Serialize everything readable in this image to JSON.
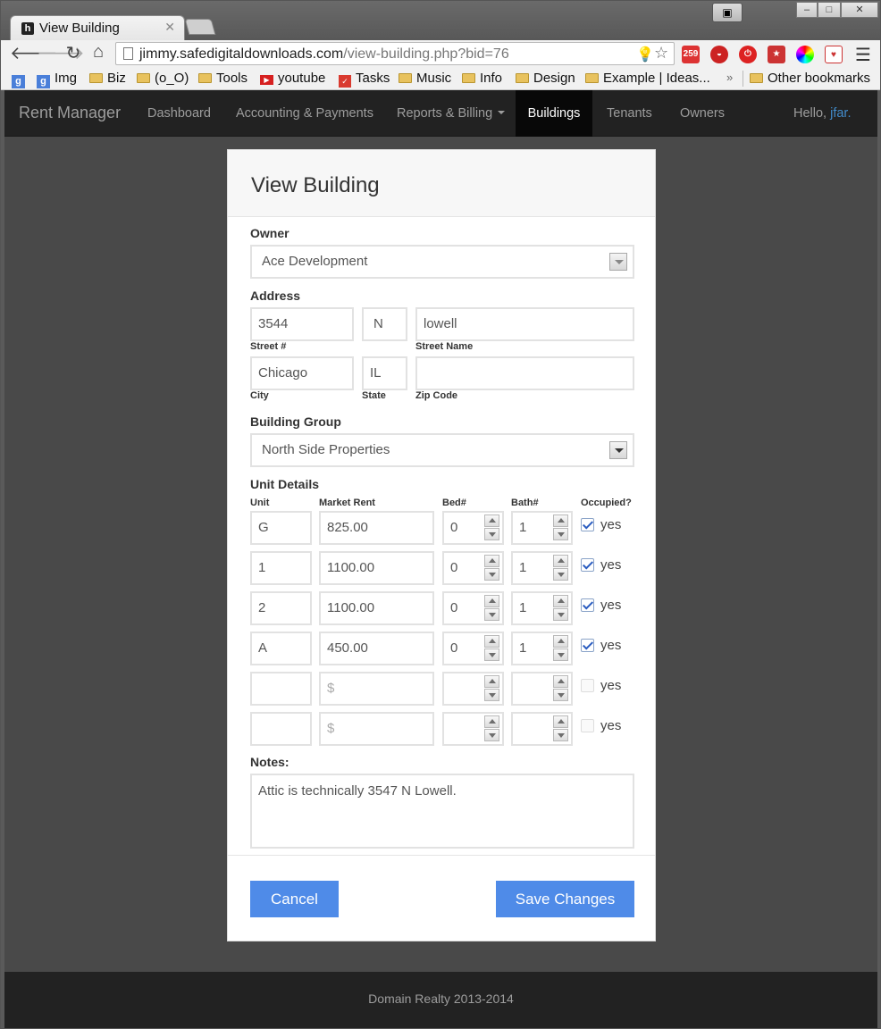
{
  "browser": {
    "tab_title": "View Building",
    "url_host": "jimmy.safedigitaldownloads.com",
    "url_path": "/view-building.php?bid=76",
    "badge_count": "259",
    "bookmarks": [
      {
        "label": "",
        "icon": "google-icon"
      },
      {
        "label": "Img",
        "icon": "google-icon"
      },
      {
        "label": "Biz",
        "icon": "folder-icon"
      },
      {
        "label": "(o_O)",
        "icon": "folder-icon"
      },
      {
        "label": "Tools",
        "icon": "folder-icon"
      },
      {
        "label": "youtube",
        "icon": "youtube-icon"
      },
      {
        "label": "Tasks",
        "icon": "tasks-icon"
      },
      {
        "label": "Music",
        "icon": "folder-icon"
      },
      {
        "label": "Info",
        "icon": "folder-icon"
      },
      {
        "label": "Design",
        "icon": "folder-icon"
      },
      {
        "label": "Example | Ideas...",
        "icon": "folder-icon"
      }
    ],
    "overflow_label": "»",
    "other_bookmarks": "Other bookmarks"
  },
  "navbar": {
    "brand": "Rent Manager",
    "links": [
      "Dashboard",
      "Accounting & Payments",
      "Reports & Billing",
      "Buildings",
      "Tenants",
      "Owners"
    ],
    "active": "Buildings",
    "greeting": "Hello, ",
    "user": "jfar."
  },
  "form": {
    "title": "View Building",
    "owner_label": "Owner",
    "owner_value": "Ace Development",
    "address_label": "Address",
    "street_number": "3544",
    "direction": "N",
    "street_name": "lowell",
    "street_number_label": "Street #",
    "street_name_label": "Street Name",
    "city": "Chicago",
    "state": "IL",
    "zip": "",
    "city_label": "City",
    "state_label": "State",
    "zip_label": "Zip Code",
    "group_label": "Building Group",
    "group_value": "North Side Properties",
    "units_label": "Unit Details",
    "col_unit": "Unit",
    "col_rent": "Market Rent",
    "col_bed": "Bed#",
    "col_bath": "Bath#",
    "col_occupied": "Occupied?",
    "rent_placeholder": "$",
    "occupied_text": "yes",
    "units": [
      {
        "unit": "G",
        "rent": "825.00",
        "bed": "0",
        "bath": "1",
        "occupied": true
      },
      {
        "unit": "1",
        "rent": "1100.00",
        "bed": "0",
        "bath": "1",
        "occupied": true
      },
      {
        "unit": "2",
        "rent": "1100.00",
        "bed": "0",
        "bath": "1",
        "occupied": true
      },
      {
        "unit": "A",
        "rent": "450.00",
        "bed": "0",
        "bath": "1",
        "occupied": true
      },
      {
        "unit": "",
        "rent": "",
        "bed": "",
        "bath": "",
        "occupied": false
      },
      {
        "unit": "",
        "rent": "",
        "bed": "",
        "bath": "",
        "occupied": false
      }
    ],
    "notes_label": "Notes:",
    "notes_value": "Attic is technically 3547 N Lowell.",
    "cancel_label": "Cancel",
    "save_label": "Save Changes"
  },
  "footer": {
    "text": "Domain Realty 2013-2014"
  },
  "colors": {
    "primary_button": "#4f8be8",
    "navbar": "#222222",
    "link": "#428bca"
  }
}
